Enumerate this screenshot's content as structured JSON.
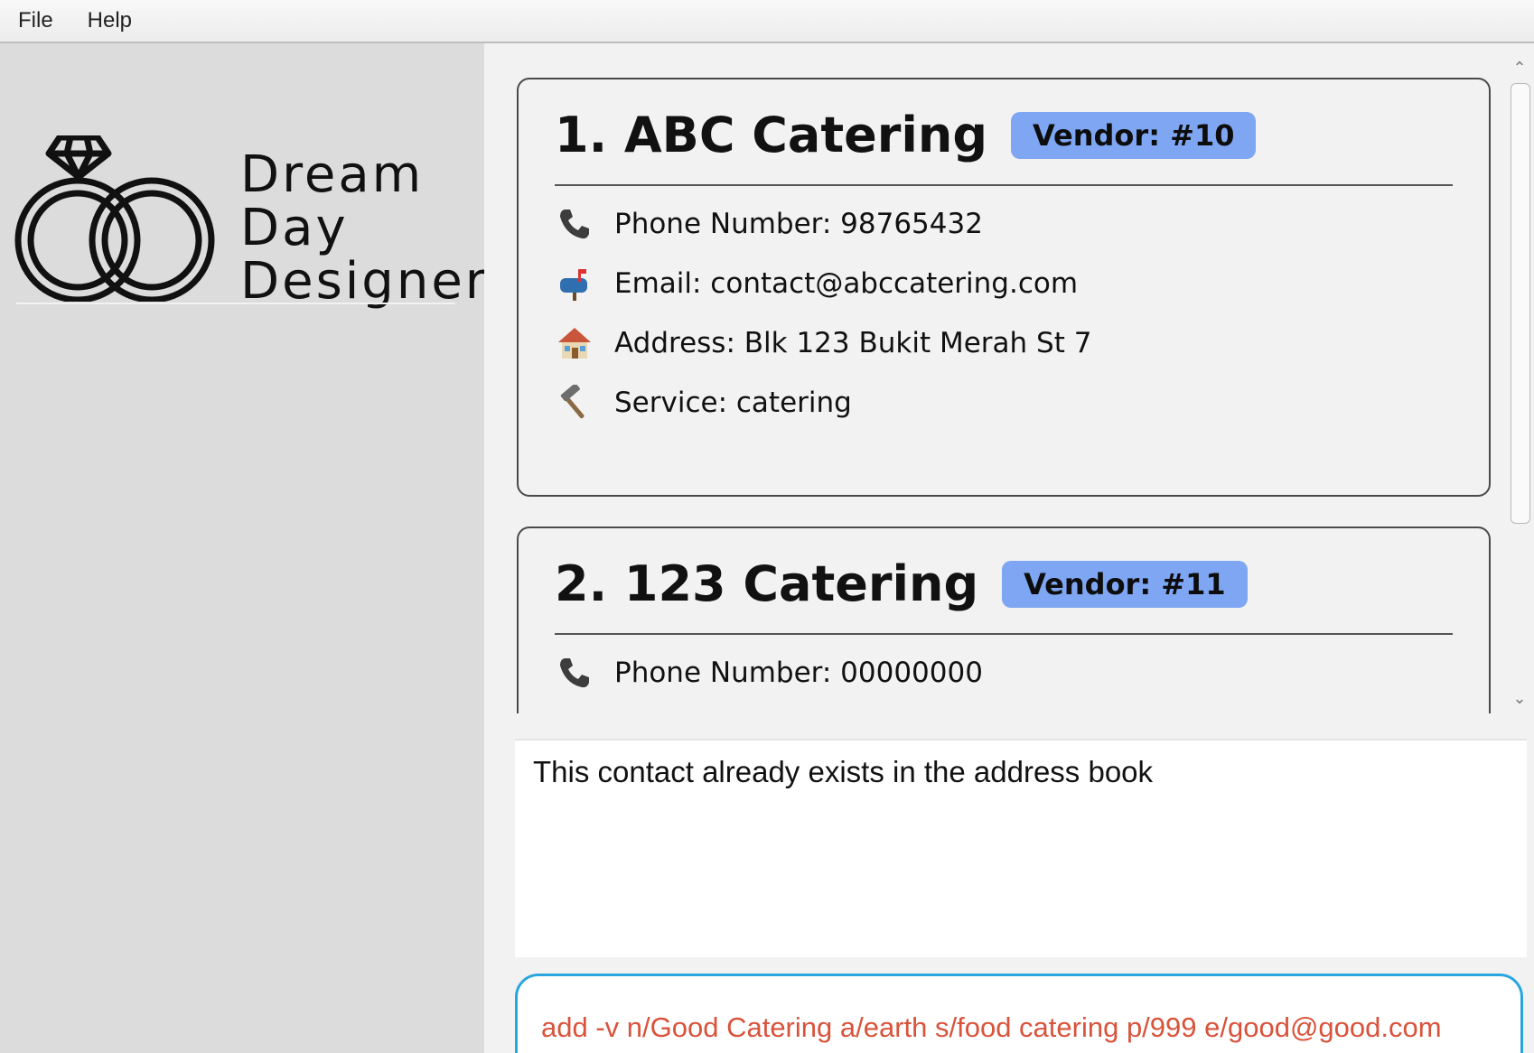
{
  "menu": {
    "items": [
      "File",
      "Help"
    ]
  },
  "logo": {
    "lines": [
      "Dream",
      "Day",
      "Designer"
    ]
  },
  "contacts": [
    {
      "title": "1. ABC Catering",
      "badge": "Vendor: #10",
      "fields": [
        {
          "icon": "phone-icon",
          "text": "Phone Number: 98765432"
        },
        {
          "icon": "mailbox-icon",
          "text": "Email: contact@abccatering.com"
        },
        {
          "icon": "house-icon",
          "text": "Address: Blk 123 Bukit Merah St 7"
        },
        {
          "icon": "hammer-icon",
          "text": "Service: catering"
        }
      ]
    },
    {
      "title": "2. 123 Catering",
      "badge": "Vendor: #11",
      "fields": [
        {
          "icon": "phone-icon",
          "text": "Phone Number: 00000000"
        }
      ]
    }
  ],
  "result": {
    "message": "This contact already exists in the address book"
  },
  "command": {
    "value": "add -v n/Good Catering a/earth s/food catering p/999 e/good@good.com"
  },
  "colors": {
    "badge": "#7fa6f2",
    "command_text": "#d9533b",
    "command_border": "#2aa6df"
  }
}
